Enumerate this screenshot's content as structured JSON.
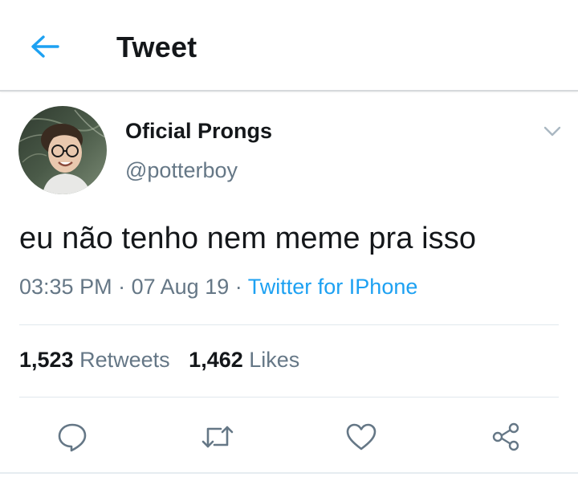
{
  "header": {
    "back_icon": "arrow-left-icon",
    "title": "Tweet"
  },
  "tweet": {
    "display_name": "Oficial Prongs",
    "handle": "@potterboy",
    "text": "eu não tenho nem meme pra isso",
    "time": "03:35 PM",
    "date": "07 Aug 19",
    "separator": "·",
    "source": "Twitter for IPhone",
    "retweets_count": "1,523",
    "retweets_label": "Retweets",
    "likes_count": "1,462",
    "likes_label": "Likes"
  },
  "actions": [
    {
      "name": "reply",
      "icon": "speech-bubble-icon"
    },
    {
      "name": "retweet",
      "icon": "retweet-arrows-icon"
    },
    {
      "name": "like",
      "icon": "heart-outline-icon"
    },
    {
      "name": "share",
      "icon": "share-nodes-icon"
    }
  ],
  "colors": {
    "accent": "#1da1f2",
    "primary_text": "#14171a",
    "secondary_text": "#657786",
    "divider": "#e1e8ed",
    "icon_gray": "#657786"
  }
}
